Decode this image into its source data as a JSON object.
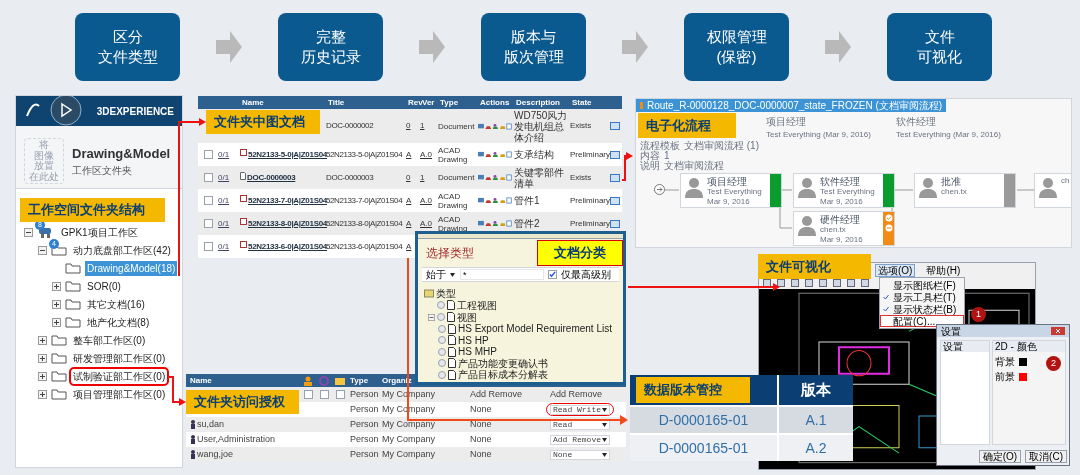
{
  "steps": [
    {
      "lines": [
        "区分",
        "文件类型"
      ]
    },
    {
      "lines": [
        "完整",
        "历史记录"
      ]
    },
    {
      "lines": [
        "版本与",
        "版次管理"
      ]
    },
    {
      "lines": [
        "权限管理",
        "(保密)"
      ]
    },
    {
      "lines": [
        "文件",
        "可视化"
      ]
    }
  ],
  "workspace": {
    "brand": "3DEXPERIENCE",
    "image_hint": [
      "将",
      "图像",
      "放置",
      "在此处"
    ],
    "folder_title": "Drawing&Model",
    "folder_type": "工作区文件夹",
    "callout": "工作空间文件夹结构",
    "tree": [
      {
        "label": "GPK1项目工作区",
        "badge": "8",
        "expanded": true,
        "selected": false,
        "children": [
          {
            "label": "动力底盘部工作区(42)",
            "badge": "4",
            "expanded": true,
            "selected": false,
            "children": [
              {
                "label": "Drawing&Model(18)",
                "selected": true
              },
              {
                "label": "SOR(0)",
                "expanded": false,
                "selected": false
              },
              {
                "label": "其它文档(16)",
                "expanded": false,
                "selected": false
              },
              {
                "label": "地产化文档(8)",
                "expanded": false,
                "selected": false
              }
            ]
          },
          {
            "label": "整车部工作区(0)",
            "expanded": false,
            "selected": false
          },
          {
            "label": "研发管理部工作区(0)",
            "expanded": false,
            "selected": false
          },
          {
            "label": "试制验证部工作区(0)",
            "expanded": false,
            "selected": false,
            "highlighted": true
          },
          {
            "label": "项目管理部工作区(0)",
            "expanded": false,
            "selected": false
          }
        ]
      }
    ]
  },
  "documents": {
    "callout": "文件夹中图文档",
    "columns": [
      "Name",
      "Title",
      "Rev",
      "Ver",
      "Type",
      "Actions",
      "Description",
      "State"
    ],
    "rows": [
      {
        "title": "DOC-0000002",
        "rev": "0",
        "ver": "1",
        "type": "Document",
        "description": "WD750风力发电机组总体介绍",
        "state": "Exists"
      },
      {
        "kind": "drawing",
        "checked": false,
        "count": "0/1",
        "name": "52N2133-5-0|A|Z01S04",
        "title": "52N2133-5-0|A|Z01S04",
        "rev": "A",
        "ver": "A.0",
        "type": "ACAD Drawing",
        "description": "支承结构",
        "state": "Preliminary"
      },
      {
        "kind": "document",
        "checked": false,
        "count": "0/1",
        "name": "DOC-0000003",
        "title": "DOC-0000003",
        "rev": "0",
        "ver": "1",
        "type": "Document",
        "description": "关键零部件清单",
        "state": "Exists"
      },
      {
        "kind": "drawing",
        "checked": false,
        "count": "0/1",
        "name": "52N2133-7-0|A|Z01S04",
        "title": "52N2133-7-0|A|Z01S04",
        "rev": "A",
        "ver": "A.0",
        "type": "ACAD Drawing",
        "description": "管件1",
        "state": "Preliminary"
      },
      {
        "kind": "drawing",
        "checked": false,
        "count": "0/1",
        "name": "52N2133-8-0|A|Z01S04",
        "title": "52N2133-8-0|A|Z01S04",
        "rev": "A",
        "ver": "A.0",
        "type": "ACAD Drawing",
        "description": "管件2",
        "state": "Preliminary"
      },
      {
        "kind": "drawing",
        "checked": false,
        "count": "0/1",
        "name": "52N2133-6-0|A|Z01S04",
        "title": "52N2133-6-0|A|Z01S04",
        "rev": "A"
      }
    ]
  },
  "type_dialog": {
    "title": "选择类型",
    "callout": "文档分类",
    "match": "始于",
    "filter": "*",
    "top_level_only": {
      "label": "仅最高级别",
      "checked": true
    },
    "tree": {
      "label": "类型",
      "children": [
        {
          "label": "工程视图",
          "selected": false
        },
        {
          "label": "视图",
          "selected": false,
          "expanded": true,
          "children": [
            {
              "label": "HS Export Model Requirement List",
              "selected": false
            },
            {
              "label": "HS HP",
              "selected": false
            },
            {
              "label": "HS MHP",
              "selected": false
            },
            {
              "label": "产品功能变更确认书",
              "selected": false
            },
            {
              "label": "产品目标成本分解表",
              "selected": false
            }
          ]
        }
      ]
    }
  },
  "access": {
    "callout": "文件夹访问授权",
    "columns": [
      "Name",
      "Type",
      "Organiz"
    ],
    "rows": [
      {
        "kind": "group",
        "checks": [
          false,
          false,
          false
        ],
        "type": "Person",
        "organization": "My Company",
        "column_5": "Add Remove",
        "access": "Add Remove"
      },
      {
        "kind": "hidden",
        "type": "Person",
        "organization": "My Company",
        "column_5": "None",
        "access": "Read Write",
        "circled": true
      },
      {
        "kind": "person",
        "name": "su,dan",
        "type": "Person",
        "organization": "My Company",
        "column_5": "None",
        "access": "Read",
        "circled": false
      },
      {
        "kind": "person",
        "name": "User,Administration",
        "type": "Person",
        "organization": "My Company",
        "column_5": "None",
        "access": "Add Remove",
        "circled": false
      },
      {
        "kind": "person",
        "name": "wang,joe",
        "type": "Person",
        "organization": "My Company",
        "column_5": "None",
        "access": "None",
        "circled": false
      }
    ]
  },
  "workflow": {
    "title": "Route_R-0000128_DOC-0000007_state_FROZEN (文档审阅流程)",
    "callout": "电子化流程",
    "info": [
      {
        "label": "流程模板",
        "value": "文档审阅流程 (1)"
      },
      {
        "label": "内容",
        "value": "1"
      },
      {
        "label": "说明",
        "value": "文档审阅流程"
      }
    ],
    "approvals": [
      {
        "role": "项目经理",
        "detail": "Test Everything (Mar 9, 2016)"
      },
      {
        "role": "软件经理",
        "detail": "Test Everything (Mar 9, 2016)"
      }
    ],
    "nodes": [
      {
        "role": "项目经理",
        "name": "Test Everything",
        "date": "Mar 9, 2016",
        "kind": "done"
      },
      {
        "role": "软件经理",
        "name": "Test Everything",
        "date": "Mar 9, 2016",
        "kind": "done"
      },
      {
        "role": "硬件经理",
        "name": "chen.tx",
        "date": "Mar 9, 2016",
        "kind": "active"
      },
      {
        "role": "批准",
        "name": "chen.tx",
        "kind": "pending"
      },
      {
        "name": "ch"
      }
    ]
  },
  "viewer": {
    "callout": "文件可视化",
    "menus": [
      {
        "label": "选项(O)",
        "selected": true
      },
      {
        "label": "帮助(H)",
        "selected": false
      }
    ],
    "menu_items": [
      {
        "label": "显示图纸栏(F)",
        "checked": false
      },
      {
        "label": "显示工具栏(T)",
        "checked": true
      },
      {
        "label": "显示状态栏(B)",
        "checked": true
      },
      {
        "label": "配置(C)...",
        "checked": false,
        "highlighted": true
      }
    ],
    "markers": [
      "1",
      "2"
    ],
    "settings": {
      "title": "设置",
      "tabs": [
        "设置",
        "2D - 颜色"
      ],
      "colors": [
        {
          "label": "背景",
          "color": "#000000"
        },
        {
          "label": "前景",
          "color": "#ff0000"
        }
      ],
      "buttons": [
        "确定(O)",
        "取消(C)"
      ]
    }
  },
  "versions": {
    "columns": [
      "数据版本管控",
      "版本"
    ],
    "rows": [
      {
        "id": "D-0000165-01",
        "version": "A.1"
      },
      {
        "id": "D-0000165-01",
        "version": "A.2"
      }
    ]
  }
}
